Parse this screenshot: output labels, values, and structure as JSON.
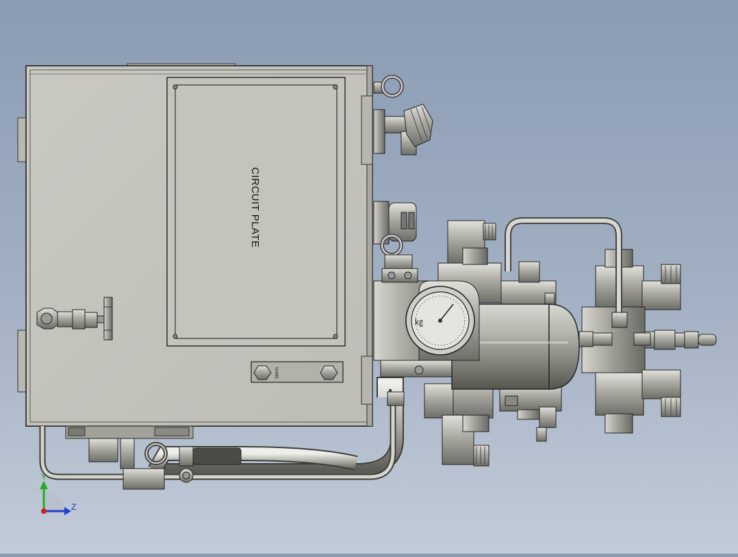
{
  "viewport": {
    "background_top": "#8a9bb3",
    "background_bottom": "#c2cbd8"
  },
  "model": {
    "plate_label": "CIRCUIT PLATE",
    "name_plate_text": "NAME"
  },
  "triad": {
    "y_label": "Y",
    "z_label": "Z",
    "y_color": "#1fae1f",
    "z_color": "#1f3fd0",
    "x_color": "#d01f1f"
  }
}
